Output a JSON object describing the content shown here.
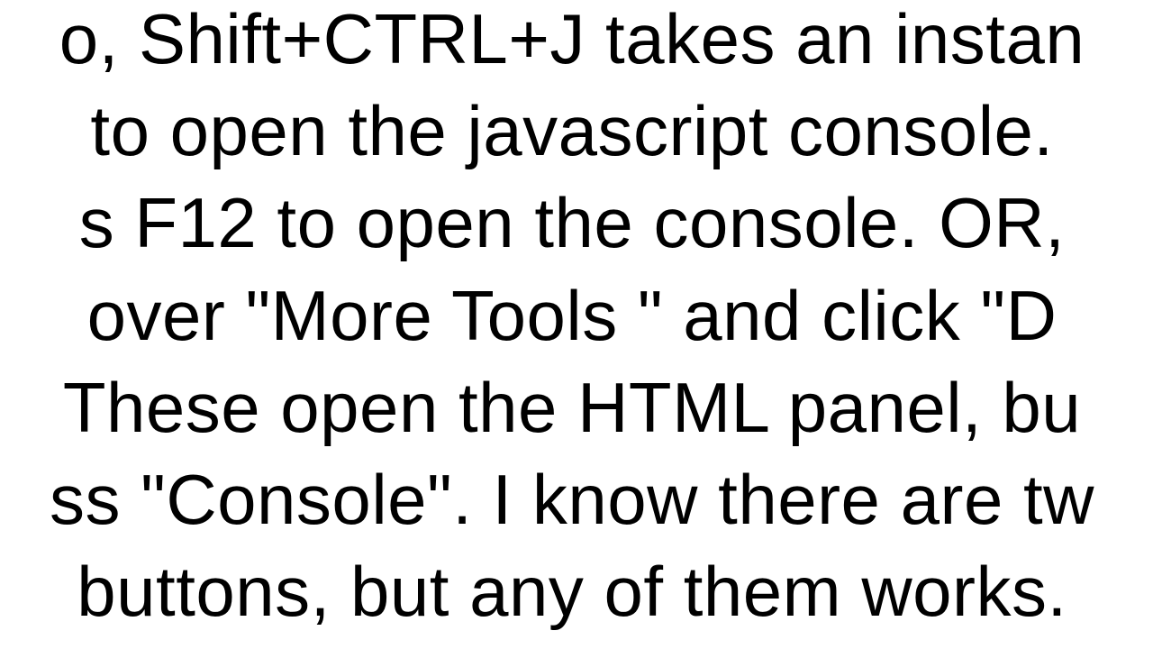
{
  "lines": [
    "o, Shift+CTRL+J takes an instan",
    "to open the javascript console.",
    "s F12 to open the console. OR,",
    "over \"More Tools    \" and click \"D",
    "These open the HTML panel, bu",
    "ss \"Console\". I know there are tw",
    "buttons, but any of them works."
  ]
}
